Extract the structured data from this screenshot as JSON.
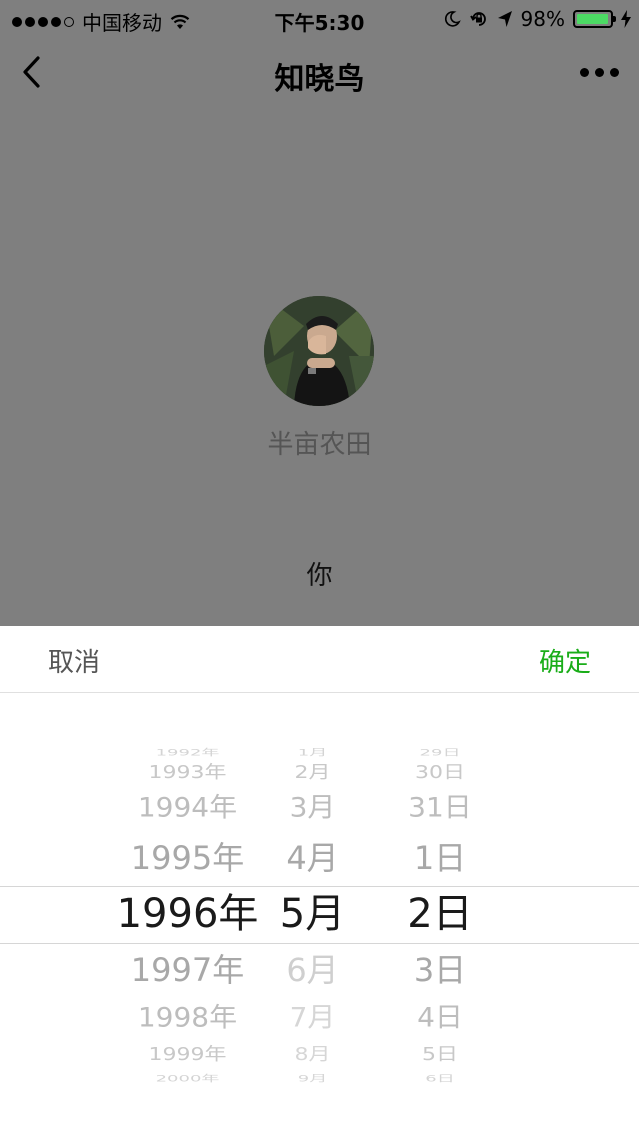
{
  "status_bar": {
    "carrier": "中国移动",
    "time": "下午5:30",
    "battery": "98%",
    "battery_level": 0.98,
    "accent_color": "#4cd964"
  },
  "nav": {
    "title": "知晓鸟",
    "back_icon": "chevron-left-icon",
    "more_icon": "more-dots-icon"
  },
  "profile": {
    "name": "半亩农田",
    "prompt": "你"
  },
  "picker": {
    "cancel_label": "取消",
    "confirm_label": "确定",
    "confirm_color": "#1aad19",
    "years": [
      "1992年",
      "1993年",
      "1994年",
      "1995年",
      "1996年",
      "1997年",
      "1998年",
      "1999年",
      "2000年"
    ],
    "months": [
      "1月",
      "2月",
      "3月",
      "4月",
      "5月",
      "6月",
      "7月",
      "8月",
      "9月"
    ],
    "days": [
      "29日",
      "30日",
      "31日",
      "1日",
      "2日",
      "3日",
      "4日",
      "5日",
      "6日"
    ],
    "selected": {
      "year": "1996年",
      "month": "5月",
      "day": "2日"
    }
  }
}
